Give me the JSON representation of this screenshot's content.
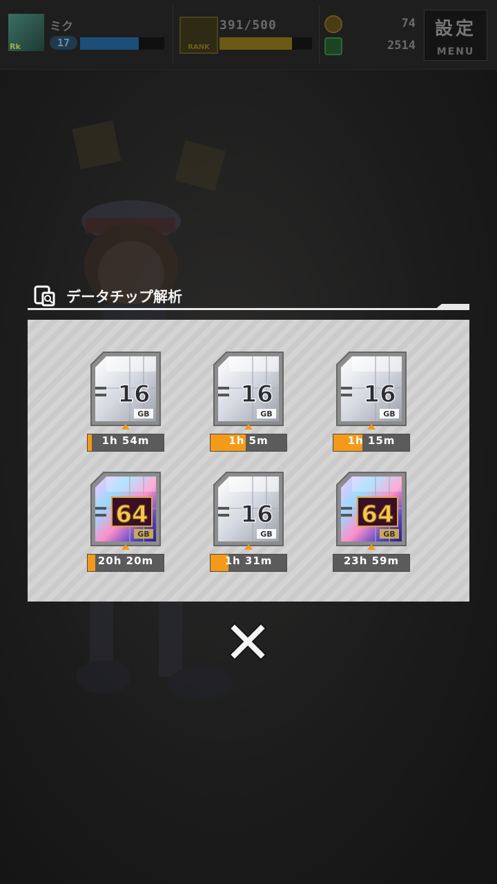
{
  "header": {
    "player_name": "ミク",
    "avatar_tag": "Rk",
    "level": "17",
    "xp_fraction": 0.7,
    "rank_label": "RANK",
    "stamina": "391/500",
    "stamina_fraction": 0.78,
    "currency_1": "74",
    "currency_2": "2514",
    "menu_kanji": "設定",
    "menu_label": "MENU"
  },
  "dialog": {
    "title": "データチップ解析",
    "chips": [
      {
        "capacity": "16",
        "unit": "GB",
        "time": "1h 54m",
        "progress": 0.05,
        "tier": "silver"
      },
      {
        "capacity": "16",
        "unit": "GB",
        "time": "1h 5m",
        "progress": 0.46,
        "tier": "silver"
      },
      {
        "capacity": "16",
        "unit": "GB",
        "time": "1h 15m",
        "progress": 0.38,
        "tier": "silver"
      },
      {
        "capacity": "64",
        "unit": "GB",
        "time": "20h 20m",
        "progress": 0.1,
        "tier": "rainbow"
      },
      {
        "capacity": "16",
        "unit": "GB",
        "time": "1h 31m",
        "progress": 0.24,
        "tier": "silver"
      },
      {
        "capacity": "64",
        "unit": "GB",
        "time": "23h 59m",
        "progress": 0.0,
        "tier": "rainbow"
      }
    ],
    "close_icon": "close-x-icon"
  },
  "colors": {
    "timer_fill": "#f39a1a",
    "timer_bg": "#5b5b5b",
    "panel_stripe": "#d4d4d4"
  }
}
